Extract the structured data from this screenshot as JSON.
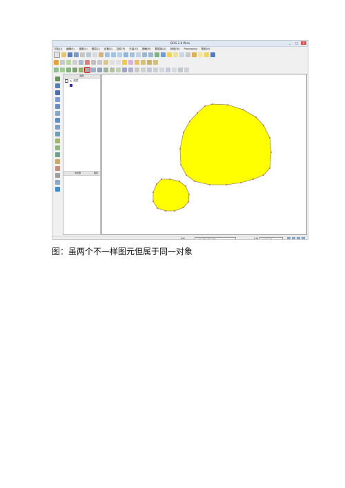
{
  "window": {
    "title": "QGIS 2.8 Wien",
    "controls": [
      "_",
      "□",
      "×"
    ]
  },
  "menubar": {
    "items": [
      "项目(J)",
      "编辑(E)",
      "视图(V)",
      "图层(L)",
      "设置(S)",
      "插件(P)",
      "矢量(O)",
      "栅格(R)",
      "数据库(D)",
      "网络(W)",
      "Processing",
      "帮助(H)"
    ]
  },
  "layers_panel": {
    "title": "图层",
    "layer_name": "线层",
    "layer_color": "#3a2ca8"
  },
  "lower_panel": {
    "left_label": "浏览器",
    "right_label": "图层"
  },
  "map": {
    "polygon_fill": "#ffff00",
    "polygon_stroke": "#a08c5a",
    "vertex_color": "#c0484f"
  },
  "statusbar": {
    "coord_label": "坐标",
    "coord_value": "123.4583,28.6183",
    "scale_label": "比例",
    "scale_value": "1:193,717"
  },
  "caption": "图：虽两个不一样图元但属于同一对象"
}
